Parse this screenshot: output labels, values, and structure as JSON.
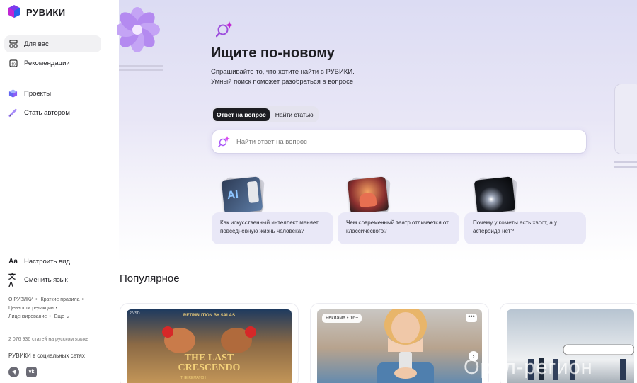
{
  "brand": {
    "name": "РУВИКИ"
  },
  "sidebar": {
    "items": [
      {
        "label": "Для вас",
        "icon": "grid-icon"
      },
      {
        "label": "Рекомендации",
        "icon": "calendar-icon"
      },
      {
        "label": "Проекты",
        "icon": "cube-icon"
      },
      {
        "label": "Стать автором",
        "icon": "pen-icon"
      }
    ],
    "bottom": [
      {
        "label": "Настроить вид",
        "icon": "font-size-icon"
      },
      {
        "label": "Сменить язык",
        "icon": "translate-icon"
      }
    ],
    "links": {
      "about": "О РУВИКИ",
      "rules": "Краткие правила",
      "values": "Ценности редакции",
      "license": "Лицензирование",
      "more": "Еще"
    },
    "article_count": "2 076 936 статей на русском языке",
    "social_title": "РУВИКИ в социальных сетях",
    "social": [
      "telegram-icon",
      "vk-icon"
    ]
  },
  "hero": {
    "title": "Ищите по-новому",
    "subtitle_line1": "Спрашивайте то, что хотите найти в РУВИКИ.",
    "subtitle_line2": "Умный поиск поможет разобраться в вопросе",
    "tabs": [
      {
        "label": "Ответ на вопрос",
        "active": true
      },
      {
        "label": "Найти статью",
        "active": false
      }
    ],
    "search_placeholder": "Найти ответ на вопрос"
  },
  "questions": [
    {
      "text": "Как искусственный интеллект меняет повседневную жизнь человека?"
    },
    {
      "text": "Чем современный театр отличается от классического?"
    },
    {
      "text": "Почему у кометы есть хвост, а у астероида нет?"
    }
  ],
  "popular": {
    "title": "Популярное",
    "cards": [
      {
        "poster_top": "RETRIBUTION BY SALAS",
        "poster_title_1": "THE LAST",
        "poster_title_2": "CRESCENDO",
        "poster_bottom": "THE REMATCH",
        "corner": "2 VSD"
      },
      {
        "badge": "Реклама • 16+"
      },
      {
        "badge": ""
      }
    ]
  },
  "watermark": "Орел-регион",
  "colors": {
    "accent": "#8b5cf6",
    "hero_bg": "#dcdcf3",
    "card_bg": "#e9e8f7"
  }
}
